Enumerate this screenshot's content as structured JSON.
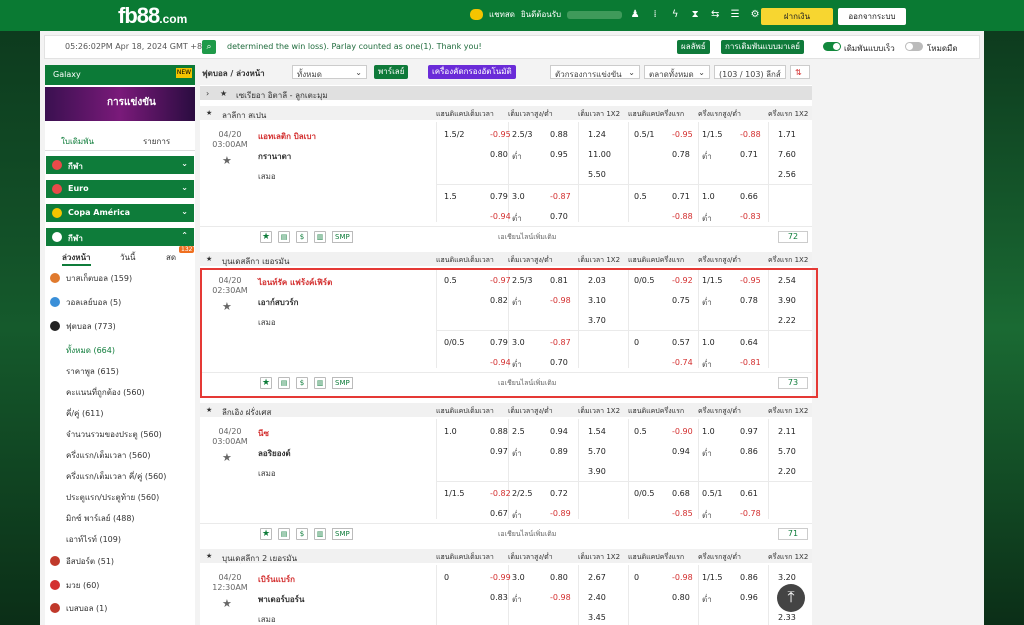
{
  "header": {
    "logo": "fb88",
    "logo_suffix": ".com",
    "chat_label": "แชทสด",
    "welcome": "ยินดีต้อนรับ",
    "deposit_label": "ฝากเงิน",
    "logout_label": "ออกจากระบบ",
    "icons": [
      "chat-icon",
      "user-icon",
      "signal-icon",
      "lightning-icon",
      "vs-icon",
      "swap-icon",
      "list-icon",
      "gear-icon"
    ]
  },
  "infobar": {
    "clock": "05:26:02PM Apr 18, 2024 GMT +8",
    "marquee": "determined the win loss). Parlay counted as one(1). Thank you!",
    "results_btn": "ผลลัพธ์",
    "bet_options_btn": "การเดิมพันแบบมาเลย์",
    "quick_bet_label": "เดิมพันแบบเร็ว",
    "dark_mode_label": "โหมดมืด"
  },
  "sidebar": {
    "galaxy": "Galaxy",
    "banner_text": "การแข่งขัน",
    "tab_bet": "ใบเดิมพัน",
    "tab_list": "รายการ",
    "categories": [
      "กีฬา",
      "Euro",
      "Copa América",
      "กีฬา"
    ],
    "subtabs": [
      "ล่วงหน้า",
      "วันนี้",
      "สด"
    ],
    "live_badge": "132",
    "sports": [
      {
        "label": "บาสเก็ตบอล",
        "count": "(159)",
        "color": "#e07a2e"
      },
      {
        "label": "วอลเลย์บอล",
        "count": "(5)",
        "color": "#3a8fd8"
      },
      {
        "label": "ฟุตบอล",
        "count": "(773)",
        "color": "#222222"
      }
    ],
    "football_sub": [
      {
        "label": "ทั้งหมด",
        "count": "(664)"
      },
      {
        "label": "ราคาพูล",
        "count": "(615)"
      },
      {
        "label": "คะแนนที่ถูกต้อง",
        "count": "(560)"
      },
      {
        "label": "คี่/คู่",
        "count": "(611)"
      },
      {
        "label": "จำนวนรวมของประตู",
        "count": "(560)"
      },
      {
        "label": "ครึ่งแรก/เต็มเวลา",
        "count": "(560)"
      },
      {
        "label": "ครึ่งแรก/เต็มเวลา คี่/คู่",
        "count": "(560)"
      },
      {
        "label": "ประตูแรก/ประตูท้าย",
        "count": "(560)"
      },
      {
        "label": "มิกซ์ พาร์เลย์",
        "count": "(488)"
      },
      {
        "label": "เอาท์ไรท์",
        "count": "(109)"
      }
    ],
    "more_sports": [
      {
        "label": "อีสปอร์ต",
        "count": "(51)",
        "color": "#c0392b"
      },
      {
        "label": "มวย",
        "count": "(60)",
        "color": "#d32f2f"
      },
      {
        "label": "เบสบอล",
        "count": "(1)",
        "color": "#c0392b"
      }
    ]
  },
  "filter": {
    "title": "ฟุตบอล / ล่วงหน้า",
    "select_all": "ทั้งหมด",
    "parlay_btn": "พาร์เลย์",
    "mixer_btn": "เครื่องคัดกรองอัตโนมัติ",
    "sort": "ตัวกรองการแข่งขัน",
    "market": "ตลาดทั้งหมด",
    "league_count": "(103 / 103) ลีกส์"
  },
  "columns": [
    "แฮนดิแคปเต็มเวลา",
    "เต็มเวลาสูง/ต่ำ",
    "เต็มเวลา 1X2",
    "แฮนดิแคปครึ่งแรก",
    "ครึ่งแรกสูง/ต่ำ",
    "ครึ่งแรก 1X2"
  ],
  "more_label": "เอเชียนไลน์เพิ่มเติม",
  "smp": "SMP",
  "leagues": [
    {
      "name": "เซเรียอา อิตาลี - ลูกเตะมุม",
      "collapsed": true
    },
    {
      "name": "ลาลีกา สเปน",
      "match": {
        "date": "04/20",
        "time": "03:00AM",
        "home": "แอทเลติก บิลเบา",
        "away": "กรานาดา",
        "draw": "เสมอ",
        "r1": [
          "1.5/2",
          "-0.95",
          "2.5/3",
          "0.88",
          "1.24",
          "0.5/1",
          "-0.95",
          "1/1.5",
          "-0.88",
          "1.71"
        ],
        "r2": [
          "",
          "0.80",
          "ต่ำ",
          "0.95",
          "11.00",
          "",
          "0.78",
          "ต่ำ",
          "0.71",
          "7.60"
        ],
        "r3": [
          "5.50",
          "2.56"
        ],
        "r4": [
          "1.5",
          "0.79",
          "3.0",
          "-0.87",
          "",
          "0.5",
          "0.71",
          "1.0",
          "0.66"
        ],
        "r5": [
          "",
          "-0.94",
          "ต่ำ",
          "0.70",
          "",
          "",
          "-0.88",
          "ต่ำ",
          "-0.83"
        ],
        "count": "72"
      }
    },
    {
      "name": "บุนเดสลีกา เยอรมัน",
      "match": {
        "date": "04/20",
        "time": "02:30AM",
        "home": "ไอนท์รัค แฟร้งค์เฟิร์ต",
        "away": "เอาก์สบวร์ก",
        "draw": "เสมอ",
        "r1": [
          "0.5",
          "-0.97",
          "2.5/3",
          "0.81",
          "2.03",
          "0/0.5",
          "-0.92",
          "1/1.5",
          "-0.95",
          "2.54"
        ],
        "r2": [
          "",
          "0.82",
          "ต่ำ",
          "-0.98",
          "3.10",
          "",
          "0.75",
          "ต่ำ",
          "0.78",
          "3.90"
        ],
        "r3": [
          "3.70",
          "2.22"
        ],
        "r4": [
          "0/0.5",
          "0.79",
          "3.0",
          "-0.87",
          "",
          "0",
          "0.57",
          "1.0",
          "0.64"
        ],
        "r5": [
          "",
          "-0.94",
          "ต่ำ",
          "0.70",
          "",
          "",
          "-0.74",
          "ต่ำ",
          "-0.81"
        ],
        "count": "73"
      }
    },
    {
      "name": "ลีกเอิง ฝรั่งเศส",
      "match": {
        "date": "04/20",
        "time": "03:00AM",
        "home": "นีซ",
        "away": "ลอริยองต์",
        "draw": "เสมอ",
        "r1": [
          "1.0",
          "0.88",
          "2.5",
          "0.94",
          "1.54",
          "0.5",
          "-0.90",
          "1.0",
          "0.97",
          "2.11"
        ],
        "r2": [
          "",
          "0.97",
          "ต่ำ",
          "0.89",
          "5.70",
          "",
          "0.94",
          "ต่ำ",
          "0.86",
          "5.70"
        ],
        "r3": [
          "3.90",
          "2.20"
        ],
        "r4": [
          "1/1.5",
          "-0.82",
          "2/2.5",
          "0.72",
          "",
          "0/0.5",
          "0.68",
          "0.5/1",
          "0.61"
        ],
        "r5": [
          "",
          "0.67",
          "ต่ำ",
          "-0.89",
          "",
          "",
          "-0.85",
          "ต่ำ",
          "-0.78"
        ],
        "count": "71"
      }
    },
    {
      "name": "บุนเดสลีกา 2 เยอรมัน",
      "match": {
        "date": "04/20",
        "time": "12:30AM",
        "home": "เบิร์นแบร์ก",
        "away": "พาเดอร์บอร์น",
        "draw": "เสมอ",
        "r1": [
          "0",
          "-0.99",
          "3.0",
          "0.80",
          "2.67",
          "0",
          "-0.98",
          "1/1.5",
          "0.86",
          "3.20"
        ],
        "r2": [
          "",
          "0.83",
          "ต่ำ",
          "-0.98",
          "2.40",
          "",
          "0.80",
          "ต่ำ",
          "0.96",
          "2.80"
        ],
        "r3": [
          "3.45",
          "2.33"
        ]
      }
    }
  ]
}
